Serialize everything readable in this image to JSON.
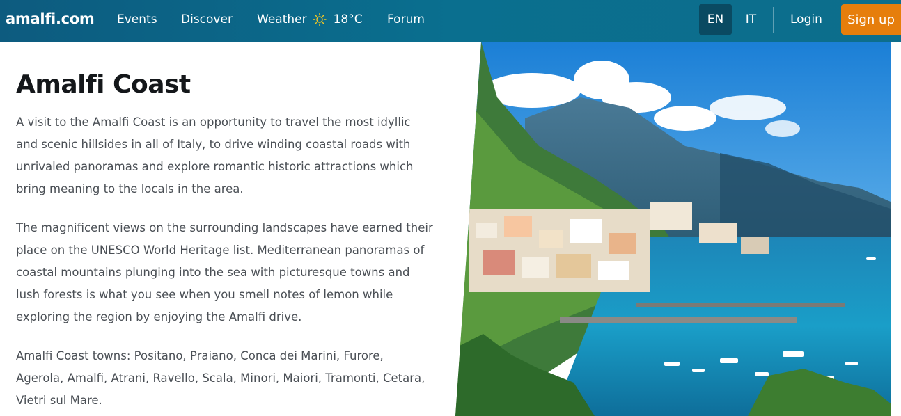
{
  "nav": {
    "brand": "amalfi.com",
    "events": "Events",
    "discover": "Discover",
    "weather_label": "Weather",
    "weather_icon": "sun-icon",
    "temperature": "18°C",
    "forum": "Forum",
    "lang_en": "EN",
    "lang_it": "IT",
    "active_lang": "EN",
    "login": "Login",
    "signup": "Sign up"
  },
  "colors": {
    "nav_bg": "#0d6e8c",
    "active_lang_bg": "#0a4a62",
    "signup_bg": "#e67e0c"
  },
  "main": {
    "title": "Amalfi Coast",
    "paragraphs": [
      "A visit to the Amalfi Coast is an opportunity to travel the most idyllic and scenic hillsides in all of Italy, to drive winding coastal roads with unrivaled panoramas and explore romantic historic attractions which bring meaning to the locals in the area.",
      "The magnificent views on the surrounding landscapes have earned their place on the UNESCO World Heritage list. Mediterranean panoramas of coastal mountains plunging into the sea with picturesque towns and lush forests is what you see when you smell notes of lemon while exploring the region by enjoying the Amalfi drive.",
      "Amalfi Coast towns: Positano, Praiano, Conca dei Marini, Furore, Agerola, Amalfi, Atrani, Ravello, Scala, Minori, Maiori, Tramonti, Cetara, Vietri sul Mare."
    ]
  }
}
